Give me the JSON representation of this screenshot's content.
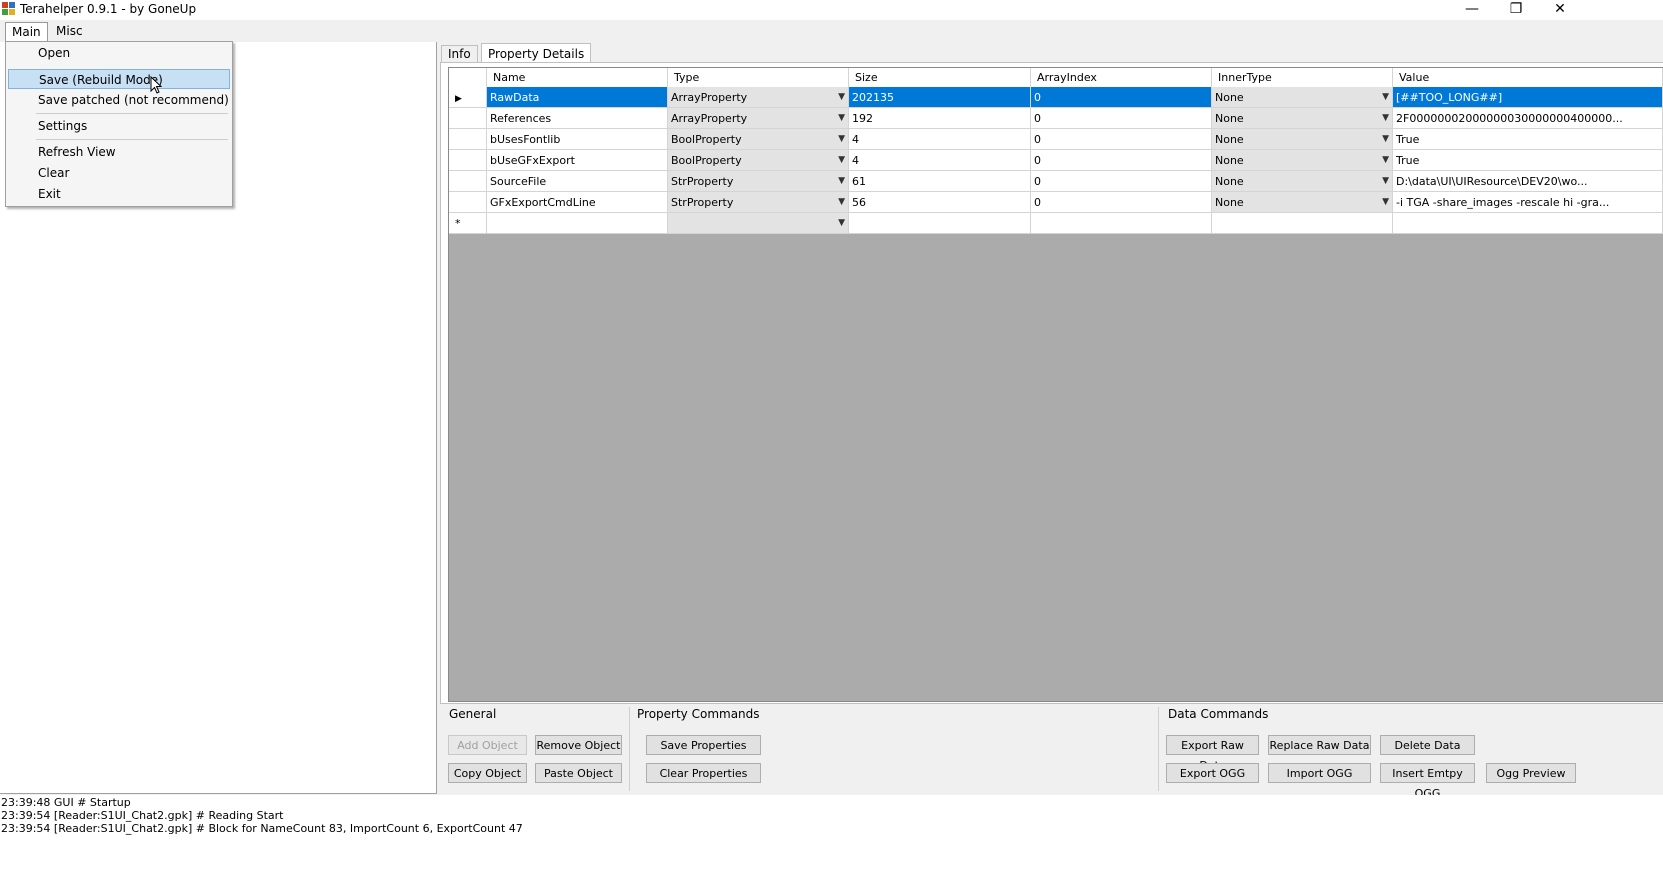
{
  "window": {
    "title": "Terahelper 0.9.1 - by GoneUp",
    "minimize_glyph": "—",
    "restore_glyph": "❐",
    "close_glyph": "✕"
  },
  "menubar": {
    "main": "Main",
    "misc": "Misc"
  },
  "main_menu": {
    "open": "Open",
    "save_rebuild": "Save (Rebuild Mode)",
    "save_patched": "Save patched (not recommend)",
    "settings": "Settings",
    "refresh_view": "Refresh View",
    "clear": "Clear",
    "exit": "Exit"
  },
  "tabs": {
    "info": "Info",
    "property_details": "Property Details"
  },
  "grid": {
    "columns": [
      "Name",
      "Type",
      "Size",
      "ArrayIndex",
      "InnerType",
      "Value"
    ],
    "new_row_marker": "*",
    "selected_marker": "▶",
    "rows": [
      {
        "name": "RawData",
        "type": "ArrayProperty",
        "size": "202135",
        "array_index": "0",
        "inner_type": "None",
        "value": "[##TOO_LONG##]"
      },
      {
        "name": "References",
        "type": "ArrayProperty",
        "size": "192",
        "array_index": "0",
        "inner_type": "None",
        "value": "2F00000002000000030000000400000..."
      },
      {
        "name": "bUsesFontlib",
        "type": "BoolProperty",
        "size": "4",
        "array_index": "0",
        "inner_type": "None",
        "value": "True"
      },
      {
        "name": "bUseGFxExport",
        "type": "BoolProperty",
        "size": "4",
        "array_index": "0",
        "inner_type": "None",
        "value": "True"
      },
      {
        "name": "SourceFile",
        "type": "StrProperty",
        "size": "61",
        "array_index": "0",
        "inner_type": "None",
        "value": "D:\\data\\UI\\UIResource\\DEV20\\wo..."
      },
      {
        "name": "GFxExportCmdLine",
        "type": "StrProperty",
        "size": "56",
        "array_index": "0",
        "inner_type": "None",
        "value": "-i TGA -share_images -rescale hi -gra..."
      }
    ]
  },
  "commands": {
    "general_label": "General",
    "property_label": "Property Commands",
    "data_label": "Data Commands",
    "add_object": "Add Object",
    "remove_object": "Remove Object",
    "copy_object": "Copy Object",
    "paste_object": "Paste Object",
    "save_properties": "Save Properties",
    "clear_properties": "Clear Properties",
    "export_raw_data": "Export Raw Data",
    "replace_raw_data": "Replace Raw Data",
    "delete_data": "Delete Data",
    "export_ogg": "Export OGG",
    "import_ogg": "Import OGG",
    "insert_empty_ogg": "Insert Emtpy OGG",
    "ogg_preview": "Ogg Preview"
  },
  "log": [
    "23:39:48 GUI # Startup",
    "23:39:54 [Reader:S1UI_Chat2.gpk] # Reading Start",
    "23:39:54 [Reader:S1UI_Chat2.gpk] # Block for NameCount 83, ImportCount 6, ExportCount 47"
  ],
  "colors": {
    "selection": "#0078d7",
    "menu_highlight": "#c7e0f4",
    "grid_bg": "#ababab"
  }
}
